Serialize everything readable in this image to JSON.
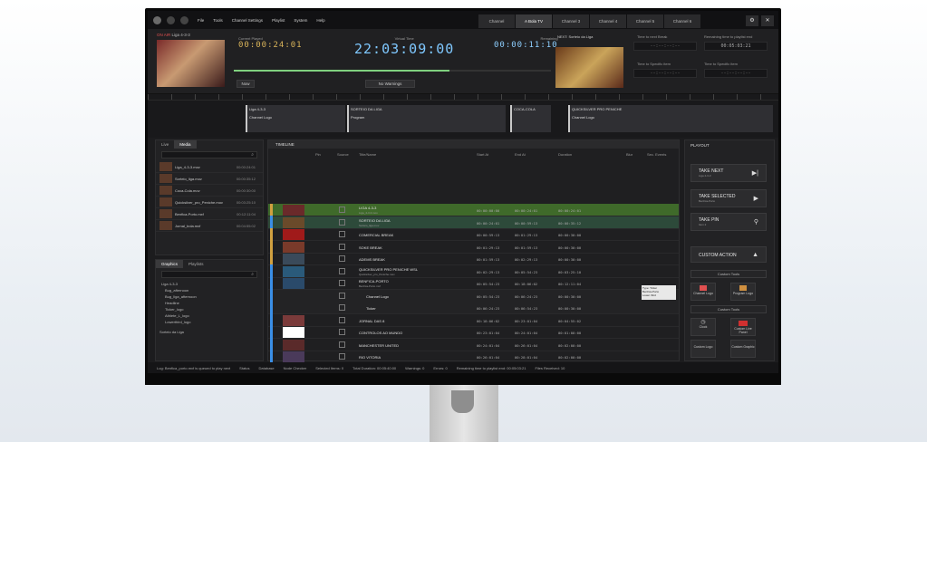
{
  "menu": {
    "items": [
      "File",
      "Tools",
      "Channel Settings",
      "Playlist",
      "System",
      "Help"
    ]
  },
  "channels": {
    "tabs": [
      "Channel",
      "A Bola TV",
      "Channel 3",
      "Channel 4",
      "Channel 5",
      "Channel 6"
    ],
    "active_index": 1
  },
  "header": {
    "onair_label": "ON AIR",
    "onair_title": "Liga 4-3-3",
    "current_played_label": "Current Played",
    "current_played": "00:00:24:01",
    "virtual_time_label": "Virtual Time",
    "virtual_time": "22:03:09:00",
    "remaining_label": "Remaining",
    "remaining": "00:00:11:10",
    "now_button": "Now",
    "warnings_button": "No Warnings",
    "next_label": "NEXT: Sorteio da Liga",
    "time_to_next_break_label": "Time to next Break",
    "remaining_playlist_label": "Remaining time to playlist end",
    "remaining_playlist": "00:05:03:21",
    "time_to_specific_item_label_1": "Time to Specific item",
    "time_to_specific_item_label_2": "Time to Specific item",
    "empty_tc": "--:--:--:--"
  },
  "ruler_blocks": [
    {
      "label": "Liga 4-3-3",
      "sub": "Channel Logo",
      "color": "#d0a040"
    },
    {
      "label": "SORTEIO DA LIGA",
      "sub": "Program",
      "color": "#3a8ee6"
    },
    {
      "label": "COCA-COLA",
      "sub": "",
      "color": "#d0a040"
    },
    {
      "label": "QUICKSILVER PRO PENICHE",
      "sub": "Channel Logo",
      "color": "#3a8ee6"
    }
  ],
  "left": {
    "tabs": [
      "Live",
      "Media"
    ],
    "media": [
      {
        "name": "Liga_4-3-3.mov",
        "duration": "00:00:24:01"
      },
      {
        "name": "Sorteio_liga.mov",
        "duration": "00:00:35:12"
      },
      {
        "name": "Coca-Cola.mov",
        "duration": "00:00:30:00"
      },
      {
        "name": "Quicksilver_pro_Peniche.mov",
        "duration": "00:03:25:10"
      },
      {
        "name": "Benfica-Porto.mxf",
        "duration": "00:12:11:04"
      },
      {
        "name": "Jornal_bola.mxf",
        "duration": "00:04:55:02"
      }
    ],
    "graphics_tabs": [
      "Graphics",
      "Playlists"
    ],
    "graphics_tree": [
      "Liga 4-3-3",
      "Bug_afternoon",
      "Bug_liga_afternoon",
      "Headline",
      "Ticker_logo",
      "Athlete_L_logo",
      "Lowerthird_logo"
    ],
    "graphics_footer": "Sorteio da Liga"
  },
  "timeline": {
    "title": "TIMELINE",
    "columns": [
      "Pin",
      "Source",
      "Title/Name",
      "Start At",
      "End At",
      "Duration",
      "Blur",
      "Sec. Events"
    ],
    "rows": [
      {
        "title": "LIGA 4-3-3",
        "sub": "Liga_4-3-3.mov",
        "start": "00:00:00:00",
        "end": "00:00:24:01",
        "dur": "00:00:24:01",
        "state": "playing",
        "marker": "#d0a040",
        "thumb": "#6a2a2a"
      },
      {
        "title": "SORTEIO DA LIGA",
        "sub": "Sorteio_liga.mov",
        "start": "00:00:24:01",
        "end": "00:00:59:13",
        "dur": "00:00:35:12",
        "state": "next",
        "marker": "#3a8ee6",
        "thumb": "#6a4a2a"
      },
      {
        "title": "COMERCIAL BREAK",
        "sub": "",
        "start": "00:00:59:13",
        "end": "00:01:29:13",
        "dur": "00:00:30:00",
        "state": "",
        "marker": "#d0a040",
        "thumb": "#a01a1a"
      },
      {
        "title": "SOKE BREAK",
        "sub": "",
        "start": "00:01:29:13",
        "end": "00:01:59:13",
        "dur": "00:00:30:00",
        "state": "",
        "marker": "#d0a040",
        "thumb": "#7a3a2a"
      },
      {
        "title": "ADEMS BREAK",
        "sub": "",
        "start": "00:01:59:13",
        "end": "00:02:29:13",
        "dur": "00:00:30:00",
        "state": "",
        "marker": "#d0a040",
        "thumb": "#3a4a5a"
      },
      {
        "title": "QUICKSILVER PRO PENICHE WSL",
        "sub": "Quicksilver_pro_Peniche.mov",
        "start": "00:02:29:13",
        "end": "00:05:54:23",
        "dur": "00:03:25:10",
        "state": "",
        "marker": "#3a8ee6",
        "thumb": "#2a5a7a"
      },
      {
        "title": "BENFICA-PORTO",
        "sub": "Benfica-Porto.mxf",
        "start": "00:05:54:23",
        "end": "00:18:06:02",
        "dur": "00:12:11:04",
        "state": "",
        "marker": "#3a8ee6",
        "thumb": "#2a4a6a"
      },
      {
        "title": "Channel Logo",
        "sub": "",
        "start": "00:05:54:23",
        "end": "00:06:24:23",
        "dur": "00:00:30:00",
        "state": "child",
        "marker": "#3a8ee6",
        "thumb": ""
      },
      {
        "title": "Ticker",
        "sub": "",
        "start": "00:06:24:23",
        "end": "00:06:54:23",
        "dur": "00:00:30:00",
        "state": "child",
        "marker": "#3a8ee6",
        "thumb": ""
      },
      {
        "title": "JORNAL DAS 8",
        "sub": "",
        "start": "00:18:06:02",
        "end": "00:23:01:04",
        "dur": "00:04:55:02",
        "state": "",
        "marker": "#3a8ee6",
        "thumb": "#7a3a3a"
      },
      {
        "title": "CONTROLOS AO MUNDO",
        "sub": "",
        "start": "00:23:01:04",
        "end": "00:24:01:04",
        "dur": "00:01:00:00",
        "state": "",
        "marker": "#3a8ee6",
        "thumb": "#ffffff"
      },
      {
        "title": "MANCHESTER UNITED",
        "sub": "",
        "start": "00:24:01:04",
        "end": "00:26:01:04",
        "dur": "00:02:00:00",
        "state": "",
        "marker": "#3a8ee6",
        "thumb": "#5a2a2a"
      },
      {
        "title": "RIO VITORIA",
        "sub": "",
        "start": "00:26:01:04",
        "end": "00:28:01:04",
        "dur": "00:02:00:00",
        "state": "",
        "marker": "#3a8ee6",
        "thumb": "#4a3a5a"
      }
    ],
    "tooltip": [
      "Type: Ticker",
      "Benfica-Porto",
      "Lower third"
    ]
  },
  "playout": {
    "title": "PLAYOUT",
    "take_next": "TAKE NEXT",
    "take_next_sub": "Liga 4-3-3",
    "take_selected": "TAKE SELECTED",
    "take_selected_sub": "Benfica-Porto",
    "take_pin": "TAKE PIN",
    "take_pin_sub": "Item 2",
    "custom_action": "CUSTOM ACTION",
    "custom_tools_1": "Custom Tools",
    "channel_logo": "Channel Logo",
    "program_logo": "Program Logo",
    "custom_tools_2": "Custom Tools",
    "clock": "Clock",
    "custom_live": "Custom Live Panel",
    "custom_logo": "Custom Logo",
    "custom_graphic": "Custom Graphic"
  },
  "status": {
    "message": "Log: Benfica_porto.mxf is queued to play next",
    "status": "Status",
    "database": "Database",
    "node_checker": "Node Checker",
    "selected_items": "Selected Items: 0",
    "total_duration": "Total Duration: 00:05:40:00",
    "warnings": "Warnings: 0",
    "errors": "Errors: 0",
    "remaining": "Remaining time to playlist end: 00:05:03:21",
    "files_received": "Files Received: 10"
  }
}
